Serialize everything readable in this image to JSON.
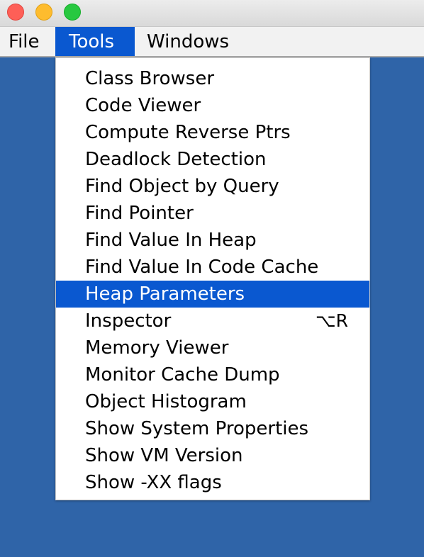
{
  "menubar": {
    "file": "File",
    "tools": "Tools",
    "windows": "Windows"
  },
  "tools_menu": {
    "items": [
      {
        "label": "Class Browser"
      },
      {
        "label": "Code Viewer"
      },
      {
        "label": "Compute Reverse Ptrs"
      },
      {
        "label": "Deadlock Detection"
      },
      {
        "label": "Find Object by Query"
      },
      {
        "label": "Find Pointer"
      },
      {
        "label": "Find Value In Heap"
      },
      {
        "label": "Find Value In Code Cache"
      },
      {
        "label": "Heap Parameters",
        "selected": true
      },
      {
        "label": "Inspector",
        "shortcut": "⌥R"
      },
      {
        "label": "Memory Viewer"
      },
      {
        "label": "Monitor Cache Dump"
      },
      {
        "label": "Object Histogram"
      },
      {
        "label": "Show System Properties"
      },
      {
        "label": "Show VM Version"
      },
      {
        "label": "Show -XX flags"
      }
    ]
  },
  "colors": {
    "desktop_background": "#2f64a8",
    "selection": "#0a58d0"
  }
}
